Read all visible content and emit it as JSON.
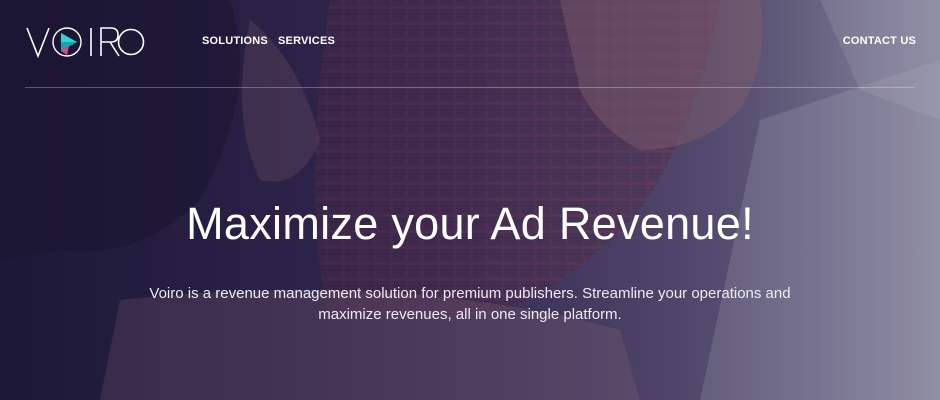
{
  "brand": {
    "logo_text": "VOIRO",
    "accent_teal": "#2fd6d0",
    "accent_pink": "#e0457b"
  },
  "nav": {
    "items": [
      {
        "label": "SOLUTIONS"
      },
      {
        "label": "SERVICES"
      }
    ],
    "contact_label": "CONTACT US"
  },
  "hero": {
    "headline": "Maximize your Ad Revenue!",
    "subtext": "Voiro is a revenue management solution for premium publishers. Streamline your operations and maximize revenues, all in one single platform.",
    "overlay_color": "#2b2346"
  }
}
